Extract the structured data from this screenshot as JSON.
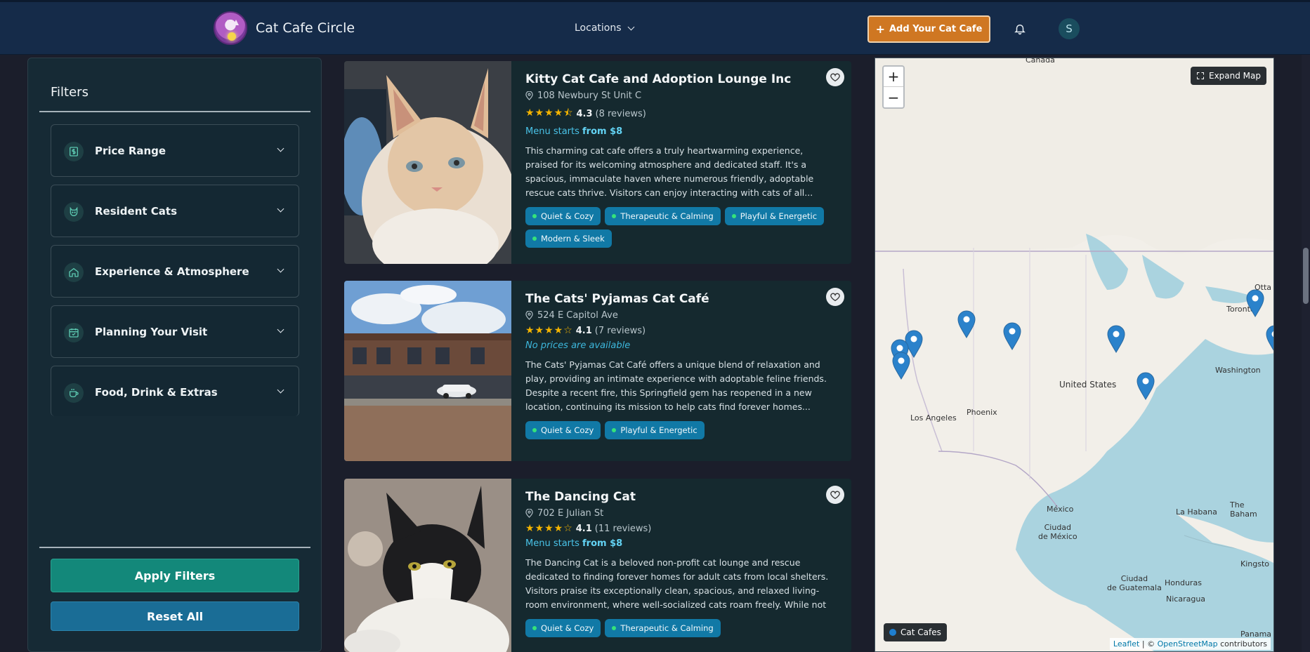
{
  "header": {
    "brand": "Cat Cafe Circle",
    "locations_label": "Locations",
    "add_button": "Add Your Cat Cafe",
    "avatar_initial": "S",
    "accent_color": "#cf7722"
  },
  "filters": {
    "title": "Filters",
    "sections": [
      {
        "label": "Price Range",
        "icon": "dollar-icon"
      },
      {
        "label": "Resident Cats",
        "icon": "cat-icon"
      },
      {
        "label": "Experience & Atmosphere",
        "icon": "home-icon"
      },
      {
        "label": "Planning Your Visit",
        "icon": "calendar-icon"
      },
      {
        "label": "Food, Drink & Extras",
        "icon": "cup-icon"
      }
    ],
    "apply_label": "Apply Filters",
    "reset_label": "Reset All"
  },
  "cafes": [
    {
      "name": "Kitty Cat Cafe and Adoption Lounge Inc",
      "address": "108 Newbury St Unit C",
      "stars": 4.5,
      "rating": "4.3",
      "reviews": "(8 reviews)",
      "price_prefix": "Menu starts ",
      "price_value": "from $8",
      "description": "This charming cat cafe offers a truly heartwarming experience, praised for its welcoming atmosphere and dedicated staff. It's a spacious, immaculate haven where numerous friendly, adoptable rescue cats thrive. Visitors can enjoy interacting with cats of all...",
      "tags": [
        "Quiet & Cozy",
        "Therapeutic & Calming",
        "Playful & Energetic",
        "Modern & Sleek"
      ]
    },
    {
      "name": "The Cats' Pyjamas Cat Café",
      "address": "524 E Capitol Ave",
      "stars": 4,
      "rating": "4.1",
      "reviews": "(7 reviews)",
      "price_none": "No prices are available",
      "description": "The Cats' Pyjamas Cat Café offers a unique blend of relaxation and play, providing an intimate experience with adoptable feline friends. Despite a recent fire, this Springfield gem has reopened in a new location, continuing its mission to help cats find forever homes...",
      "tags": [
        "Quiet & Cozy",
        "Playful & Energetic"
      ]
    },
    {
      "name": "The Dancing Cat",
      "address": "702 E Julian St",
      "stars": 4,
      "rating": "4.1",
      "reviews": "(11 reviews)",
      "price_prefix": "Menu starts ",
      "price_value": "from $8",
      "description": "The Dancing Cat is a beloved non-profit cat lounge and rescue dedicated to finding forever homes for adult cats from local shelters. Visitors praise its exceptionally clean, spacious, and relaxed living-room environment, where well-socialized cats roam freely. While not ...",
      "tags": [
        "Quiet & Cozy",
        "Therapeutic & Calming"
      ]
    }
  ],
  "map": {
    "zoom_in": "+",
    "zoom_out": "−",
    "expand_label": "Expand Map",
    "legend_label": "Cat Cafes",
    "attribution_leaflet": "Leaflet",
    "attribution_sep": " | © ",
    "attribution_osm": "OpenStreetMap",
    "attribution_tail": " contributors",
    "labels": {
      "canada": "Canada",
      "united_states": "United States",
      "phoenix": "Phoenix",
      "los_angeles": "Los Angeles",
      "toronto": "Toronto",
      "ottawa": "Otta",
      "washington": "Washington",
      "mexico": "México",
      "ciudad_mexico": "Ciudad\nde México",
      "la_habana": "La Habana",
      "kingston": "Kingsto",
      "guatemala": "Ciudad\nde Guatemala",
      "honduras": "Honduras",
      "nicaragua": "Nicaragua",
      "bahamas": "The Baham",
      "panama": "Panama"
    }
  }
}
